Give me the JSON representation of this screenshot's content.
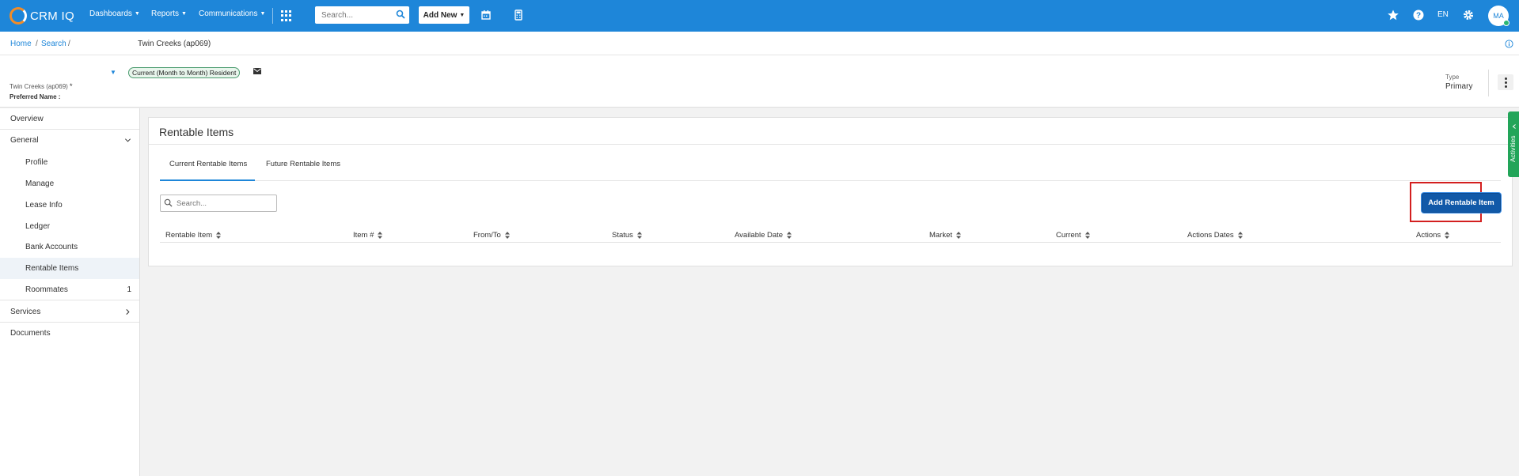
{
  "topbar": {
    "brand": "CRM IQ",
    "menus": [
      "Dashboards",
      "Reports",
      "Communications"
    ],
    "search_placeholder": "Search...",
    "add_new_label": "Add New",
    "language": "EN",
    "avatar_initials": "MA",
    "colors": {
      "bar": "#1e86d9",
      "logo_accent": "#f28c28"
    }
  },
  "breadcrumb": {
    "items": [
      "Home",
      "Search"
    ],
    "separator": "/",
    "title": "Twin Creeks (ap069)"
  },
  "header": {
    "status_badge": "Current (Month to Month) Resident",
    "property_line": "Twin Creeks (ap069)",
    "property_marker": "*",
    "preferred_name_label": "Preferred Name :",
    "type_label": "Type",
    "type_value": "Primary"
  },
  "sidebar": {
    "items": [
      {
        "label": "Overview"
      },
      {
        "label": "General"
      },
      {
        "label": "Profile"
      },
      {
        "label": "Manage"
      },
      {
        "label": "Lease Info"
      },
      {
        "label": "Ledger"
      },
      {
        "label": "Bank Accounts"
      },
      {
        "label": "Rentable Items"
      },
      {
        "label": "Roommates",
        "count": "1"
      },
      {
        "label": "Services"
      },
      {
        "label": "Documents"
      }
    ]
  },
  "main": {
    "title": "Rentable Items",
    "tabs": [
      {
        "label": "Current Rentable Items",
        "active": true
      },
      {
        "label": "Future Rentable Items",
        "active": false
      }
    ],
    "search_placeholder": "Search...",
    "add_button_label": "Add Rentable Item",
    "columns": [
      "Rentable Item",
      "Item #",
      "From/To",
      "Status",
      "Available Date",
      "Market",
      "Current",
      "Actions Dates",
      "Actions"
    ],
    "highlight_color": "#d31f1f",
    "button_color": "#1159a8"
  },
  "activities": {
    "label": "Activities",
    "color": "#22a559"
  }
}
